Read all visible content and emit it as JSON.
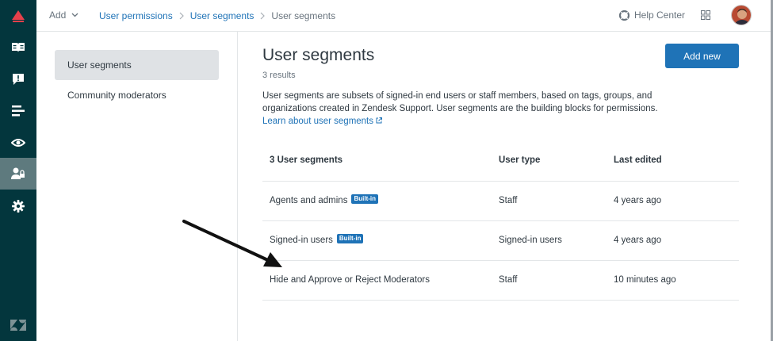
{
  "topbar": {
    "add_label": "Add",
    "breadcrumb": [
      "User permissions",
      "User segments",
      "User segments"
    ],
    "help_label": "Help Center"
  },
  "rail": {
    "icons": [
      "logo-icon",
      "guide-icon",
      "feedback-icon",
      "arrange-icon",
      "preview-icon",
      "user-permissions-icon",
      "settings-icon",
      "zendesk-icon"
    ]
  },
  "subnav": {
    "items": [
      {
        "label": "User segments"
      },
      {
        "label": "Community moderators"
      }
    ]
  },
  "main": {
    "title": "User segments",
    "results": "3 results",
    "description": "User segments are subsets of signed-in end users or staff members, based on tags, groups, and organizations created in Zendesk Support. User segments are the building blocks for permissions.",
    "learn_more": "Learn about user segments",
    "add_button": "Add new"
  },
  "table": {
    "headers": [
      "3 User segments",
      "User type",
      "Last edited"
    ],
    "badge_label": "Built-in",
    "rows": [
      {
        "name": "Agents and admins",
        "builtin": true,
        "type": "Staff",
        "edited": "4 years ago"
      },
      {
        "name": "Signed-in users",
        "builtin": true,
        "type": "Signed-in users",
        "edited": "4 years ago"
      },
      {
        "name": "Hide and Approve or Reject Moderators",
        "builtin": false,
        "type": "Staff",
        "edited": "10 minutes ago"
      }
    ]
  },
  "colors": {
    "rail": "#03363d",
    "rail_active": "#5e7a7e",
    "accent": "#1f73b7",
    "text": "#2f3941",
    "muted": "#68737d"
  }
}
